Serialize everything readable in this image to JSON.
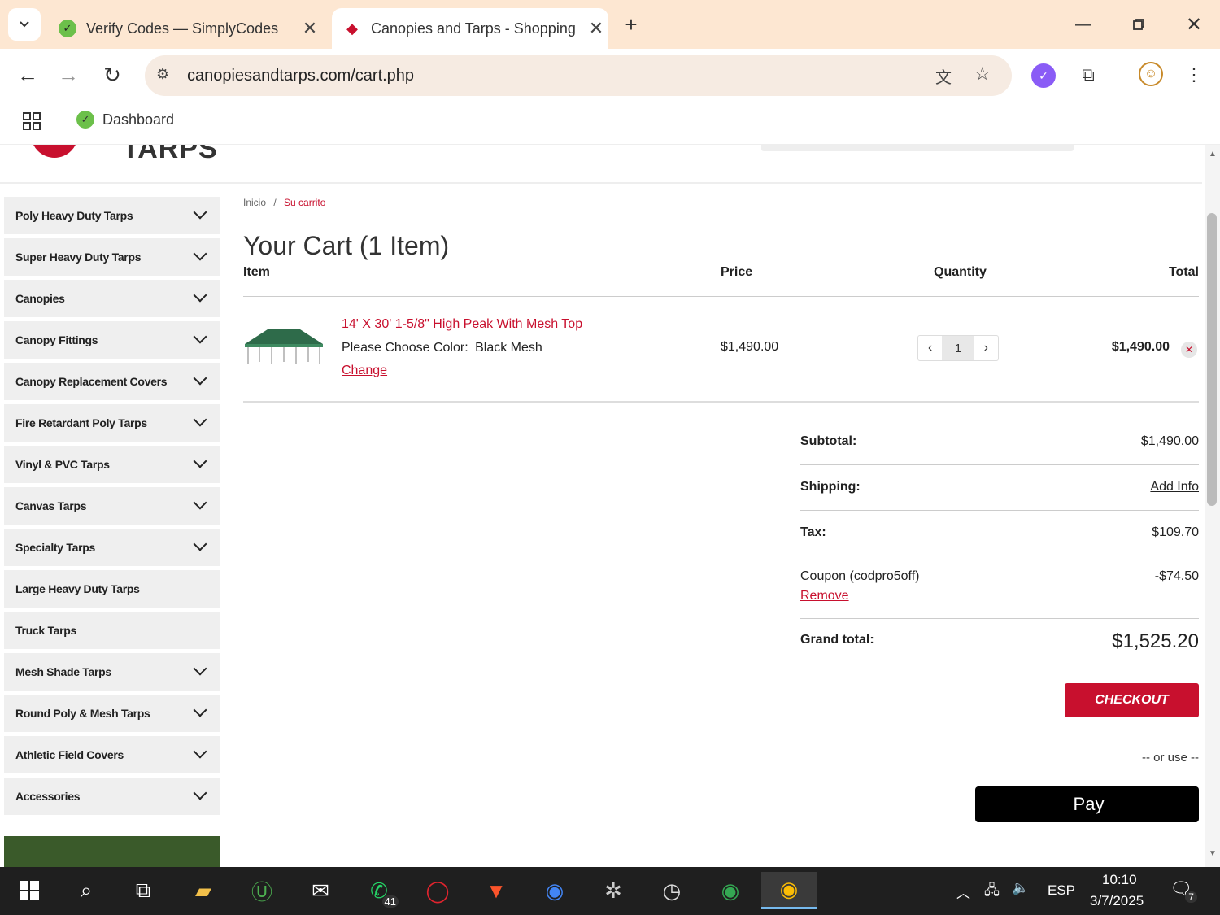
{
  "browser": {
    "tabs": [
      {
        "title": "Verify Codes — SimplyCodes",
        "favicon": "simplycodes-icon"
      },
      {
        "title": "Canopies and Tarps - Shopping",
        "favicon": "canopies-icon"
      }
    ],
    "url": "canopiesandtarps.com/cart.php",
    "bookmark": "Dashboard"
  },
  "site": {
    "logo_text": "TARPS"
  },
  "sidebar": {
    "categories": [
      {
        "label": "Poly Heavy Duty Tarps",
        "expandable": true
      },
      {
        "label": "Super Heavy Duty Tarps",
        "expandable": true
      },
      {
        "label": "Canopies",
        "expandable": true
      },
      {
        "label": "Canopy Fittings",
        "expandable": true
      },
      {
        "label": "Canopy Replacement Covers",
        "expandable": true
      },
      {
        "label": "Fire Retardant Poly Tarps",
        "expandable": true
      },
      {
        "label": "Vinyl & PVC Tarps",
        "expandable": true
      },
      {
        "label": "Canvas Tarps",
        "expandable": true
      },
      {
        "label": "Specialty Tarps",
        "expandable": true
      },
      {
        "label": "Large Heavy Duty Tarps",
        "expandable": false
      },
      {
        "label": "Truck Tarps",
        "expandable": false
      },
      {
        "label": "Mesh Shade Tarps",
        "expandable": true
      },
      {
        "label": "Round Poly & Mesh Tarps",
        "expandable": true
      },
      {
        "label": "Athletic Field Covers",
        "expandable": true
      },
      {
        "label": "Accessories",
        "expandable": true
      }
    ]
  },
  "breadcrumb": {
    "home": "Inicio",
    "sep": "/",
    "current": "Su carrito"
  },
  "cart": {
    "title": "Your Cart (1 Item)",
    "headers": {
      "item": "Item",
      "price": "Price",
      "quantity": "Quantity",
      "total": "Total"
    },
    "item": {
      "name": "14' X 30' 1-5/8\" High Peak With Mesh Top",
      "option_label": "Please Choose Color:",
      "option_value": "Black Mesh",
      "change": "Change",
      "price": "$1,490.00",
      "quantity": "1",
      "total": "$1,490.00"
    },
    "summary": {
      "subtotal_label": "Subtotal:",
      "subtotal": "$1,490.00",
      "shipping_label": "Shipping:",
      "shipping_link": "Add Info",
      "tax_label": "Tax:",
      "tax": "$109.70",
      "coupon_label": "Coupon (codpro5off)",
      "coupon": "-$74.50",
      "coupon_remove": "Remove",
      "grand_label": "Grand total:",
      "grand": "$1,525.20"
    },
    "checkout": "CHECKOUT",
    "or_use": "-- or use --",
    "apple_pay": "Pay"
  },
  "taskbar": {
    "whatsapp_badge": "41",
    "lang": "ESP",
    "time": "10:10",
    "date": "3/7/2025",
    "notif": "7"
  },
  "colors": {
    "accent": "#c8102e",
    "chrome_bg": "#fde7d2"
  }
}
